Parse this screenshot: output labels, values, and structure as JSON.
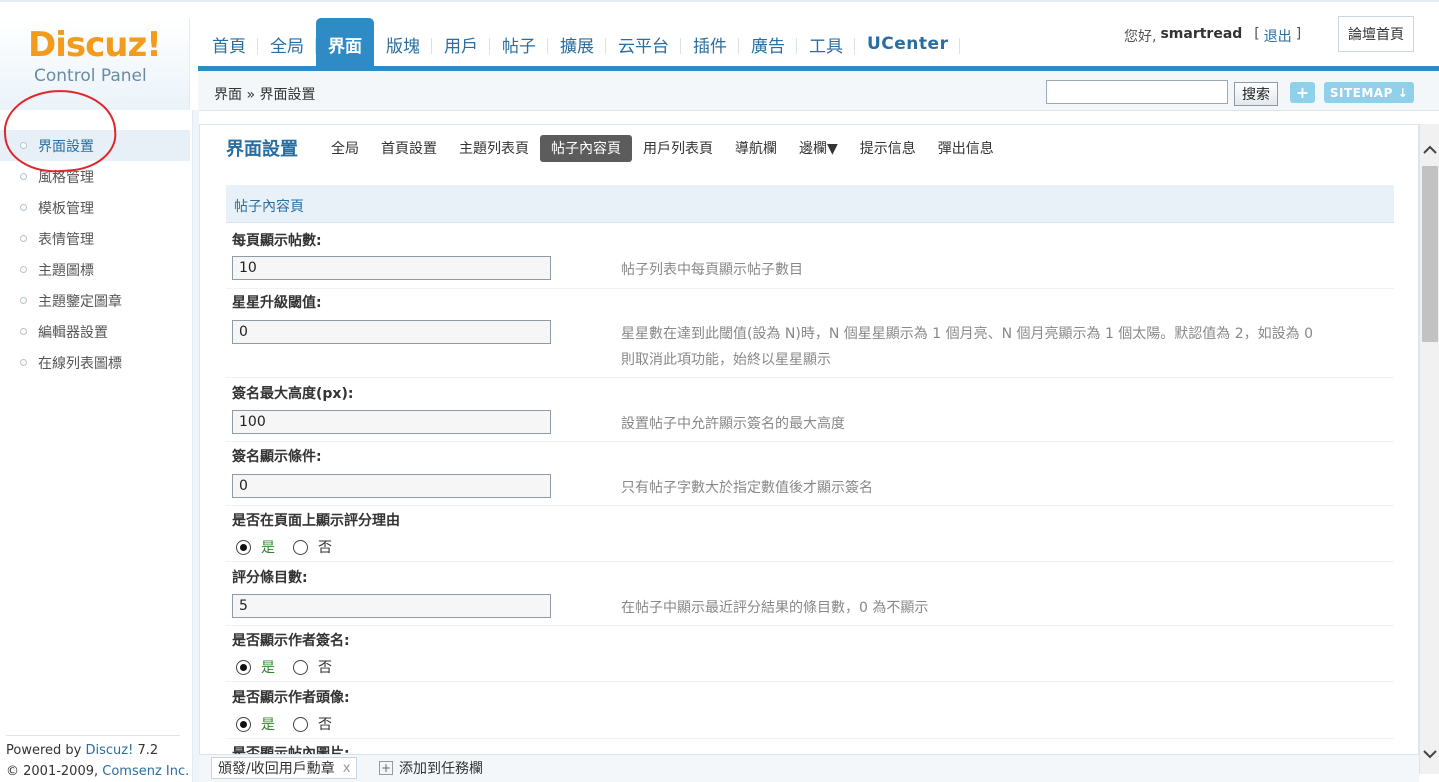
{
  "brand": {
    "logo_text": "Discuz!",
    "subtitle": "Control Panel"
  },
  "topnav": [
    {
      "label": "首頁"
    },
    {
      "label": "全局"
    },
    {
      "label": "界面",
      "active": true
    },
    {
      "label": "版塊"
    },
    {
      "label": "用戶"
    },
    {
      "label": "帖子"
    },
    {
      "label": "擴展"
    },
    {
      "label": "云平台"
    },
    {
      "label": "插件"
    },
    {
      "label": "廣告"
    },
    {
      "label": "工具"
    },
    {
      "label": "UCenter"
    }
  ],
  "user": {
    "greeting": "您好,",
    "name": "smartread",
    "logout_open": "[",
    "logout": "退出",
    "logout_close": "]",
    "forum_home": "論壇首頁"
  },
  "subbar": {
    "breadcrumb": "界面 » 界面設置",
    "search_value": "",
    "search_button": "搜索",
    "plus_icon": "+",
    "sitemap": "SITEMAP ↓"
  },
  "sidebar": {
    "items": [
      {
        "label": "界面設置",
        "active": true
      },
      {
        "label": "風格管理"
      },
      {
        "label": "模板管理"
      },
      {
        "label": "表情管理"
      },
      {
        "label": "主題圖標"
      },
      {
        "label": "主題鑒定圖章"
      },
      {
        "label": "編輯器設置"
      },
      {
        "label": "在線列表圖標"
      }
    ],
    "footer": {
      "powered": "Powered by",
      "product": "Discuz!",
      "version": "7.2",
      "copyright": "© 2001-2009,",
      "company": "Comsenz Inc."
    },
    "annotation_color": "#e0252b"
  },
  "main": {
    "title": "界面設置",
    "tabs": [
      {
        "label": "全局"
      },
      {
        "label": "首頁設置"
      },
      {
        "label": "主題列表頁"
      },
      {
        "label": "帖子內容頁",
        "active": true
      },
      {
        "label": "用戶列表頁"
      },
      {
        "label": "導航欄"
      },
      {
        "label": "邊欄▼"
      },
      {
        "label": "提示信息"
      },
      {
        "label": "彈出信息"
      }
    ],
    "section": "帖子內容頁",
    "settings": {
      "posts_per_page": {
        "label": "每頁顯示帖數:",
        "value": "10",
        "tip": "帖子列表中每頁顯示帖子數目"
      },
      "star_threshold": {
        "label": "星星升級閾值:",
        "value": "0",
        "tip_line1": "星星數在達到此閾值(設為 N)時，N 個星星顯示為 1 個月亮、N 個月亮顯示為 1 個太陽。默認值為 2，如設為 0",
        "tip_line2": "則取消此項功能，始終以星星顯示"
      },
      "sig_max_height": {
        "label": "簽名最大高度(px):",
        "value": "100",
        "tip": "設置帖子中允許顯示簽名的最大高度"
      },
      "sig_condition": {
        "label": "簽名顯示條件:",
        "value": "0",
        "tip": "只有帖子字數大於指定數值後才顯示簽名"
      },
      "show_rate_reason": {
        "label": "是否在頁面上顯示評分理由",
        "yes": "是",
        "no": "否",
        "selected": "yes"
      },
      "rate_items": {
        "label": "評分條目數:",
        "value": "5",
        "tip": "在帖子中顯示最近評分結果的條目數，0 為不顯示"
      },
      "show_author_sig": {
        "label": "是否顯示作者簽名:",
        "yes": "是",
        "no": "否",
        "selected": "yes"
      },
      "show_author_avatar": {
        "label": "是否顯示作者頭像:",
        "yes": "是",
        "no": "否",
        "selected": "yes"
      },
      "show_post_images": {
        "label": "是否顯示帖內圖片:"
      }
    }
  },
  "bottombar": {
    "medal_tab": "頒發/收回用戶勳章",
    "close_icon": "x",
    "add_task": "添加到任務欄",
    "add_icon": "+"
  },
  "scrollbar": {
    "up_icon": "chevron-up",
    "down_icon": "chevron-down"
  },
  "colors": {
    "accent": "#2e8bc6",
    "brand_orange": "#f29b1d",
    "link": "#2a6ea0",
    "yes_green": "#2a8a2a"
  }
}
